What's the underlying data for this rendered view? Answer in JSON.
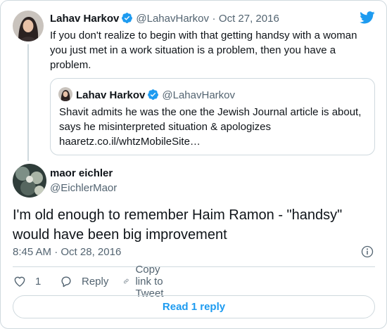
{
  "parent_tweet": {
    "author_name": "Lahav Harkov",
    "author_handle": "@LahavHarkov",
    "separator": "·",
    "date": "Oct 27, 2016",
    "text": "If you don't realize to begin with that getting handsy with a woman you just met in a work situation is a problem, then you have a problem.",
    "verified_icon": "verified-badge-icon"
  },
  "quoted_tweet": {
    "author_name": "Lahav Harkov",
    "author_handle": "@LahavHarkov",
    "text": "Shavit admits he was the one the Jewish Journal article is about, says he misinterpreted situation & apologizes haaretz.co.il/whtzMobileSite…"
  },
  "main_tweet": {
    "author_name": "maor eichler",
    "author_handle": "@EichlerMaor",
    "text": "I'm old enough to remember Haim Ramon - \"handsy\" would have been big improvement",
    "time": "8:45 AM",
    "separator": "·",
    "date": "Oct 28, 2016"
  },
  "actions": {
    "like_count": "1",
    "reply_label": "Reply",
    "copy_link_label": "Copy link to Tweet"
  },
  "read_replies_label": "Read 1 reply",
  "colors": {
    "brand": "#1d9bf0",
    "text": "#0f1419",
    "secondary": "#536471",
    "border": "#cfd9de"
  }
}
